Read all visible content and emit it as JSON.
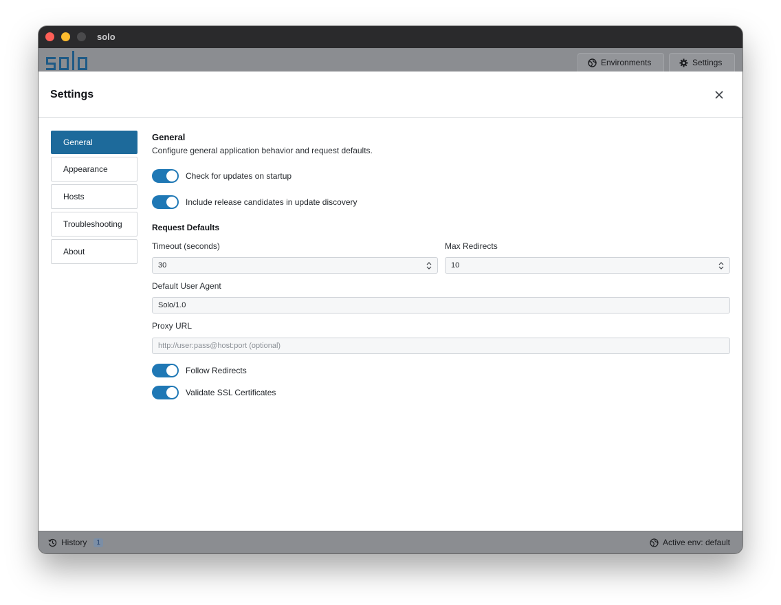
{
  "window": {
    "title": "solo"
  },
  "app": {
    "logo_text": "solo",
    "environments_button": "Environments",
    "settings_button": "Settings"
  },
  "settings_modal": {
    "title": "Settings",
    "nav": [
      {
        "label": "General",
        "active": true
      },
      {
        "label": "Appearance",
        "active": false
      },
      {
        "label": "Hosts",
        "active": false
      },
      {
        "label": "Troubleshooting",
        "active": false
      },
      {
        "label": "About",
        "active": false
      }
    ],
    "general": {
      "title": "General",
      "description": "Configure general application behavior and request defaults.",
      "toggles": [
        {
          "label": "Check for updates on startup",
          "on": true
        },
        {
          "label": "Include release candidates in update discovery",
          "on": true
        }
      ],
      "request_defaults": {
        "title": "Request Defaults",
        "timeout_label": "Timeout (seconds)",
        "timeout_value": "30",
        "max_redirects_label": "Max Redirects",
        "max_redirects_value": "10",
        "user_agent_label": "Default User Agent",
        "user_agent_value": "Solo/1.0",
        "proxy_label": "Proxy URL",
        "proxy_placeholder": "http://user:pass@host:port (optional)",
        "proxy_value": "",
        "follow_redirects_label": "Follow Redirects",
        "follow_redirects_on": true,
        "validate_ssl_label": "Validate SSL Certificates",
        "validate_ssl_on": true
      }
    }
  },
  "statusbar": {
    "history_label": "History",
    "history_count": "1",
    "active_env": "Active env: default"
  },
  "colors": {
    "accent": "#1f78b5",
    "nav_active": "#1d6a9b",
    "overlay": "#8b8d91"
  }
}
